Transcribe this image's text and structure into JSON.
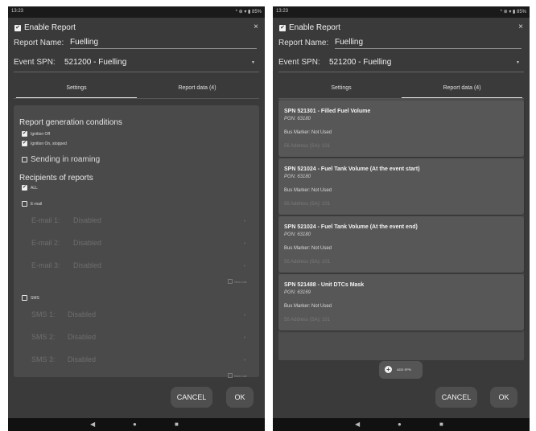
{
  "status": {
    "time": "13:23",
    "icons": "* ⊕ ▾ ▮ 85%"
  },
  "dialog": {
    "title": "Enable Report",
    "close": "×"
  },
  "report_name": {
    "label": "Report Name:",
    "value": "Fuelling"
  },
  "event_spn": {
    "label": "Event SPN:",
    "value": "521200 - Fuelling",
    "arrow": "▼"
  },
  "tabs": {
    "settings": "Settings",
    "report_data": "Report data (4)"
  },
  "settings": {
    "gen_conditions_title": "Report generation conditions",
    "ignition_off": "Ignition Off",
    "ignition_on_stopped": "Ignition On, stopped",
    "roaming": "Sending in roaming",
    "recipients_title": "Recipients of reports",
    "all": "ALL",
    "email": "E-mail",
    "email_rows": [
      {
        "label": "E-mail 1:",
        "value": "Disabled"
      },
      {
        "label": "E-mail 2:",
        "value": "Disabled"
      },
      {
        "label": "E-mail 3:",
        "value": "Disabled"
      }
    ],
    "email_new_rule": "New rule",
    "sms": "SMS",
    "sms_rows": [
      {
        "label": "SMS 1:",
        "value": "Disabled"
      },
      {
        "label": "SMS 2:",
        "value": "Disabled"
      },
      {
        "label": "SMS 3:",
        "value": "Disabled"
      }
    ],
    "sms_new_rule": "New rule"
  },
  "report_data": {
    "cards": [
      {
        "title": "SPN 521301 - Filled Fuel Volume",
        "pgn": "PGN: 63180",
        "bus": "Bus Marker: Not Used",
        "sa": "56 Address (SA): 101"
      },
      {
        "title": "SPN 521024 - Fuel Tank Volume (At the event start)",
        "pgn": "PGN: 63180",
        "bus": "Bus Marker: Not Used",
        "sa": "56 Address (SA): 101"
      },
      {
        "title": "SPN 521024 - Fuel Tank Volume (At the event end)",
        "pgn": "PGN: 63180",
        "bus": "Bus Marker: Not Used",
        "sa": "56 Address (SA): 101"
      },
      {
        "title": "SPN 521488 - Unit DTCs Mask",
        "pgn": "PGN: 63169",
        "bus": "Bus Marker: Not Used",
        "sa": "56 Address (SA): 101"
      }
    ],
    "add_spn": "ADD SPN"
  },
  "buttons": {
    "cancel": "CANCEL",
    "ok": "OK"
  },
  "nav": {
    "back": "◀",
    "home": "●",
    "recent": "■"
  }
}
